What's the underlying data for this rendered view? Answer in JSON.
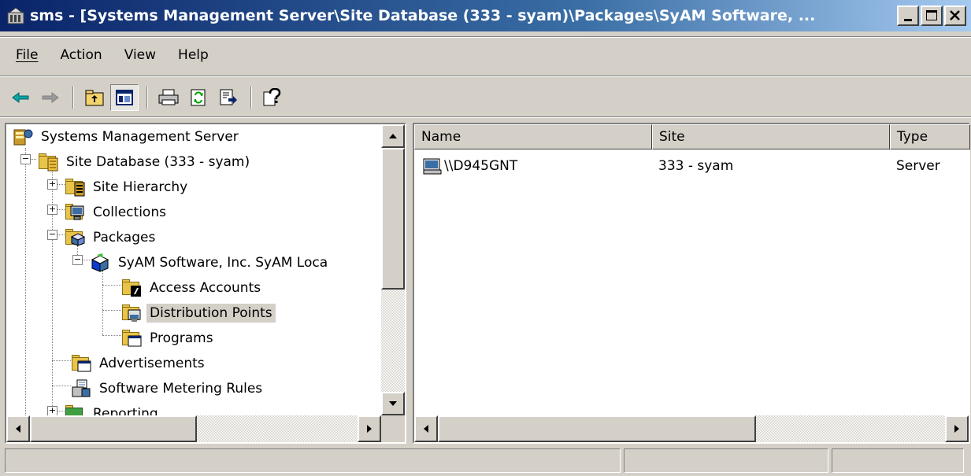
{
  "window": {
    "title": "sms - [Systems Management Server\\Site Database (333 - syam)\\Packages\\SyAM Software, ...",
    "app_icon": "sms-console-icon",
    "buttons": [
      "minimize-icon",
      "maximize-icon",
      "close-icon"
    ]
  },
  "menu": {
    "file": "File",
    "action": "Action",
    "view": "View",
    "help": "Help"
  },
  "toolbar": {
    "buttons": [
      "back-icon",
      "forward-icon",
      "up-folder-icon",
      "show-hide-tree-icon",
      "print-icon",
      "refresh-icon",
      "export-list-icon",
      "help-icon"
    ],
    "pressed": "show-hide-tree-icon"
  },
  "tree": {
    "root": "Systems Management Server",
    "site_database": "Site Database (333 - syam)",
    "site_hierarchy": "Site Hierarchy",
    "collections": "Collections",
    "packages": "Packages",
    "package": "SyAM Software, Inc. SyAM Loca",
    "access_accounts": "Access Accounts",
    "distribution_points": "Distribution Points",
    "programs": "Programs",
    "advertisements": "Advertisements",
    "software_metering": "Software Metering Rules",
    "reporting": "Reporting",
    "selected": "Distribution Points"
  },
  "list": {
    "columns": [
      "Name",
      "Site",
      "Type"
    ],
    "rows": [
      {
        "name": "\\\\D945GNT",
        "site": "333 - syam",
        "type": "Server",
        "icon": "server-share-icon"
      }
    ]
  },
  "colors": {
    "titlebar_start": "#0a246a",
    "titlebar_end": "#a6caf0",
    "chrome": "#d4d0c8"
  }
}
